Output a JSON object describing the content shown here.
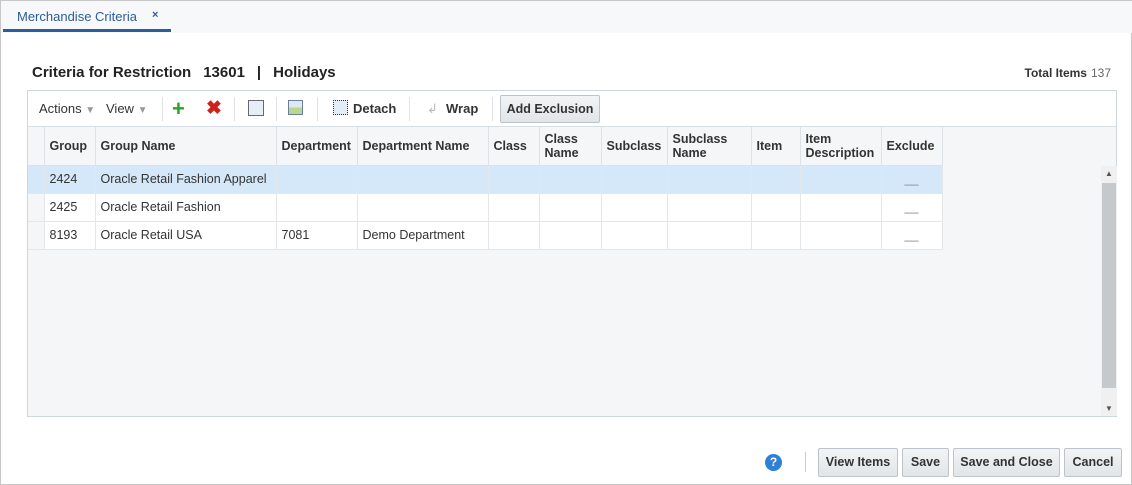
{
  "tab": {
    "label": "Merchandise Criteria",
    "close": "×"
  },
  "header": {
    "title": "Criteria for Restriction",
    "id": "13601",
    "sep": "|",
    "name": "Holidays",
    "total_label": "Total Items",
    "total_value": "137"
  },
  "toolbar": {
    "actions": "Actions",
    "view": "View",
    "detach": "Detach",
    "wrap": "Wrap",
    "add_exclusion": "Add Exclusion"
  },
  "table": {
    "columns": [
      "Group",
      "Group Name",
      "Department",
      "Department Name",
      "Class",
      "Class Name",
      "Subclass",
      "Subclass Name",
      "Item",
      "Item Description",
      "Exclude"
    ],
    "rows": [
      [
        "2424",
        "Oracle Retail Fashion Apparel",
        "",
        "",
        "",
        "",
        "",
        "",
        "",
        "",
        "__"
      ],
      [
        "2425",
        "Oracle Retail Fashion",
        "",
        "",
        "",
        "",
        "",
        "",
        "",
        "",
        "__"
      ],
      [
        "8193",
        "Oracle Retail USA",
        "7081",
        "Demo Department",
        "",
        "",
        "",
        "",
        "",
        "",
        "__"
      ]
    ]
  },
  "footer": {
    "help": "?",
    "view_items": "View Items",
    "save": "Save",
    "save_close": "Save and Close",
    "cancel": "Cancel"
  },
  "colors": {
    "accent": "#2a5d9a",
    "selected_row": "#d5e8f9"
  }
}
